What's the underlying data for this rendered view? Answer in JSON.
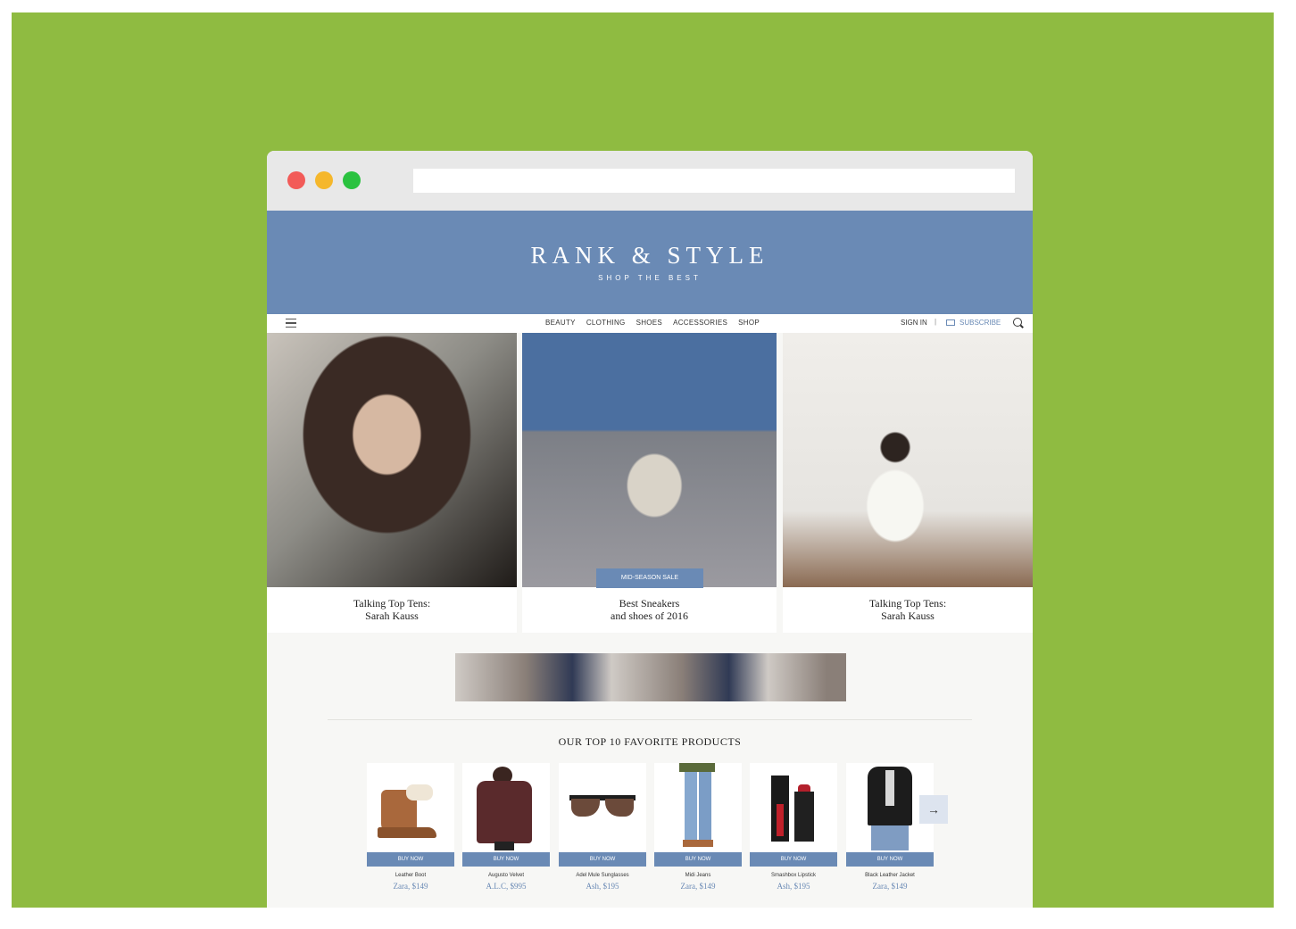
{
  "brand": {
    "logo": "RANK & STYLE",
    "tagline": "SHOP THE BEST",
    "accent": "#6a8ab5",
    "page_background": "#8fbb41"
  },
  "nav": {
    "links": [
      "BEAUTY",
      "CLOTHING",
      "SHOES",
      "ACCESSORIES",
      "SHOP"
    ],
    "sign_in": "SIGN IN",
    "separator": "|",
    "subscribe": "SUBSCRIBE"
  },
  "features": [
    {
      "line1": "Talking Top Tens:",
      "line2": "Sarah Kauss"
    },
    {
      "line1": "Best Sneakers",
      "line2": "and shoes of 2016",
      "badge": "MID-SEASON SALE"
    },
    {
      "line1": "Talking Top Tens:",
      "line2": "Sarah Kauss"
    }
  ],
  "products_section": {
    "title": "OUR TOP 10 FAVORITE PRODUCTS",
    "buy_label": "BUY NOW",
    "items": [
      {
        "name": "Leather Boot",
        "price": "Zara, $149"
      },
      {
        "name": "Augusto Velvet",
        "price": "A.L.C, $995"
      },
      {
        "name": "Adel Mule Sunglasses",
        "price": "Ash, $195"
      },
      {
        "name": "Midi Jeans",
        "price": "Zara, $149"
      },
      {
        "name": "Smashbox Lipstick",
        "price": "Ash, $195"
      },
      {
        "name": "Black Leather Jacket",
        "price": "Zara, $149"
      }
    ],
    "next_arrow": "→"
  }
}
